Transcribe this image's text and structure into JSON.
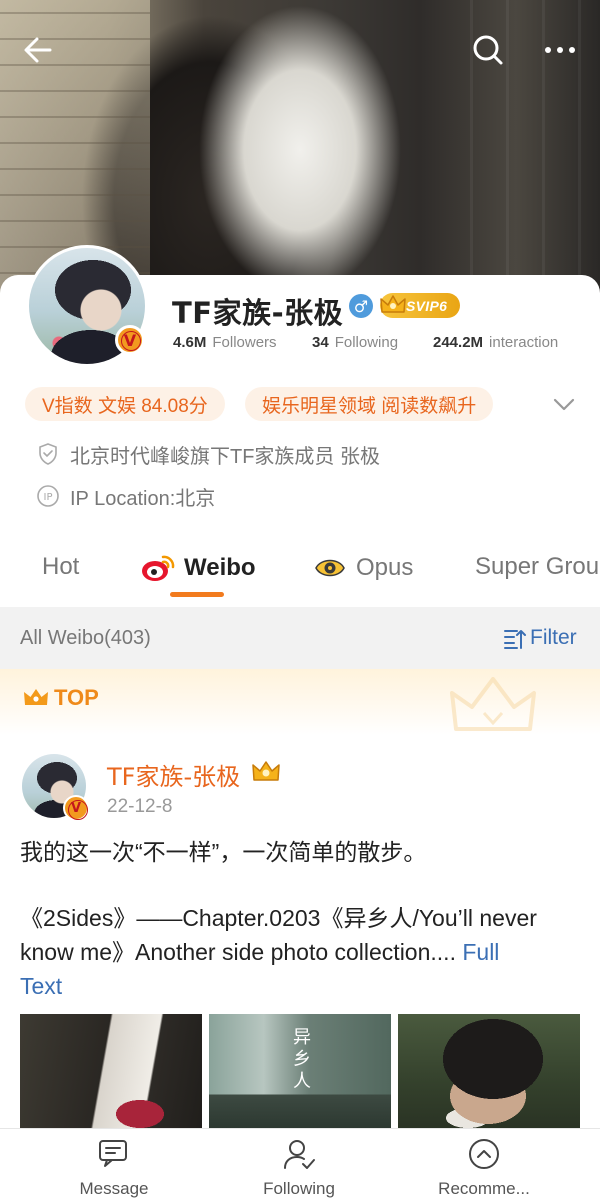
{
  "profile": {
    "name": "TF家族-张极",
    "svip_label": "SVIP6",
    "stats": [
      {
        "value": "4.6M",
        "label": "Followers"
      },
      {
        "value": "34",
        "label": "Following"
      },
      {
        "value": "244.2M",
        "label": "interaction"
      }
    ],
    "chips": [
      "V指数 文娱 84.08分",
      "娱乐明星领域 阅读数飙升"
    ],
    "verification": "北京时代峰峻旗下TF家族成员 张极",
    "ip_location": "IP Location:北京"
  },
  "tabs": [
    {
      "label": "Hot",
      "active": false
    },
    {
      "label": "Weibo",
      "active": true
    },
    {
      "label": "Opus",
      "active": false
    },
    {
      "label": "Super Grou",
      "active": false
    }
  ],
  "filter_bar": {
    "count_label": "All Weibo(403)",
    "filter_label": "Filter"
  },
  "top_banner": {
    "label": "TOP"
  },
  "post": {
    "author": "TF家族-张极",
    "date": "22-12-8",
    "line1": "我的这一次“不一样”，一次简单的散步。",
    "line2a": "《2Sides》——Chapter.0203《异乡人/You’ll never",
    "line2b": "know me》Another side photo collection....",
    "full_text_1": "Full",
    "full_text_2": "Text",
    "photo2_text": "异乡人"
  },
  "bottom_nav": [
    {
      "label": "Message",
      "icon": "message-icon"
    },
    {
      "label": "Following",
      "icon": "following-icon"
    },
    {
      "label": "Recomme...",
      "icon": "recommend-icon"
    }
  ],
  "colors": {
    "accent_orange": "#f27b1e",
    "link_blue": "#3b6fb4",
    "chip_bg": "#fdf1e6",
    "gender_blue": "#4f9bdc",
    "svip_gold": "#f0b429"
  }
}
